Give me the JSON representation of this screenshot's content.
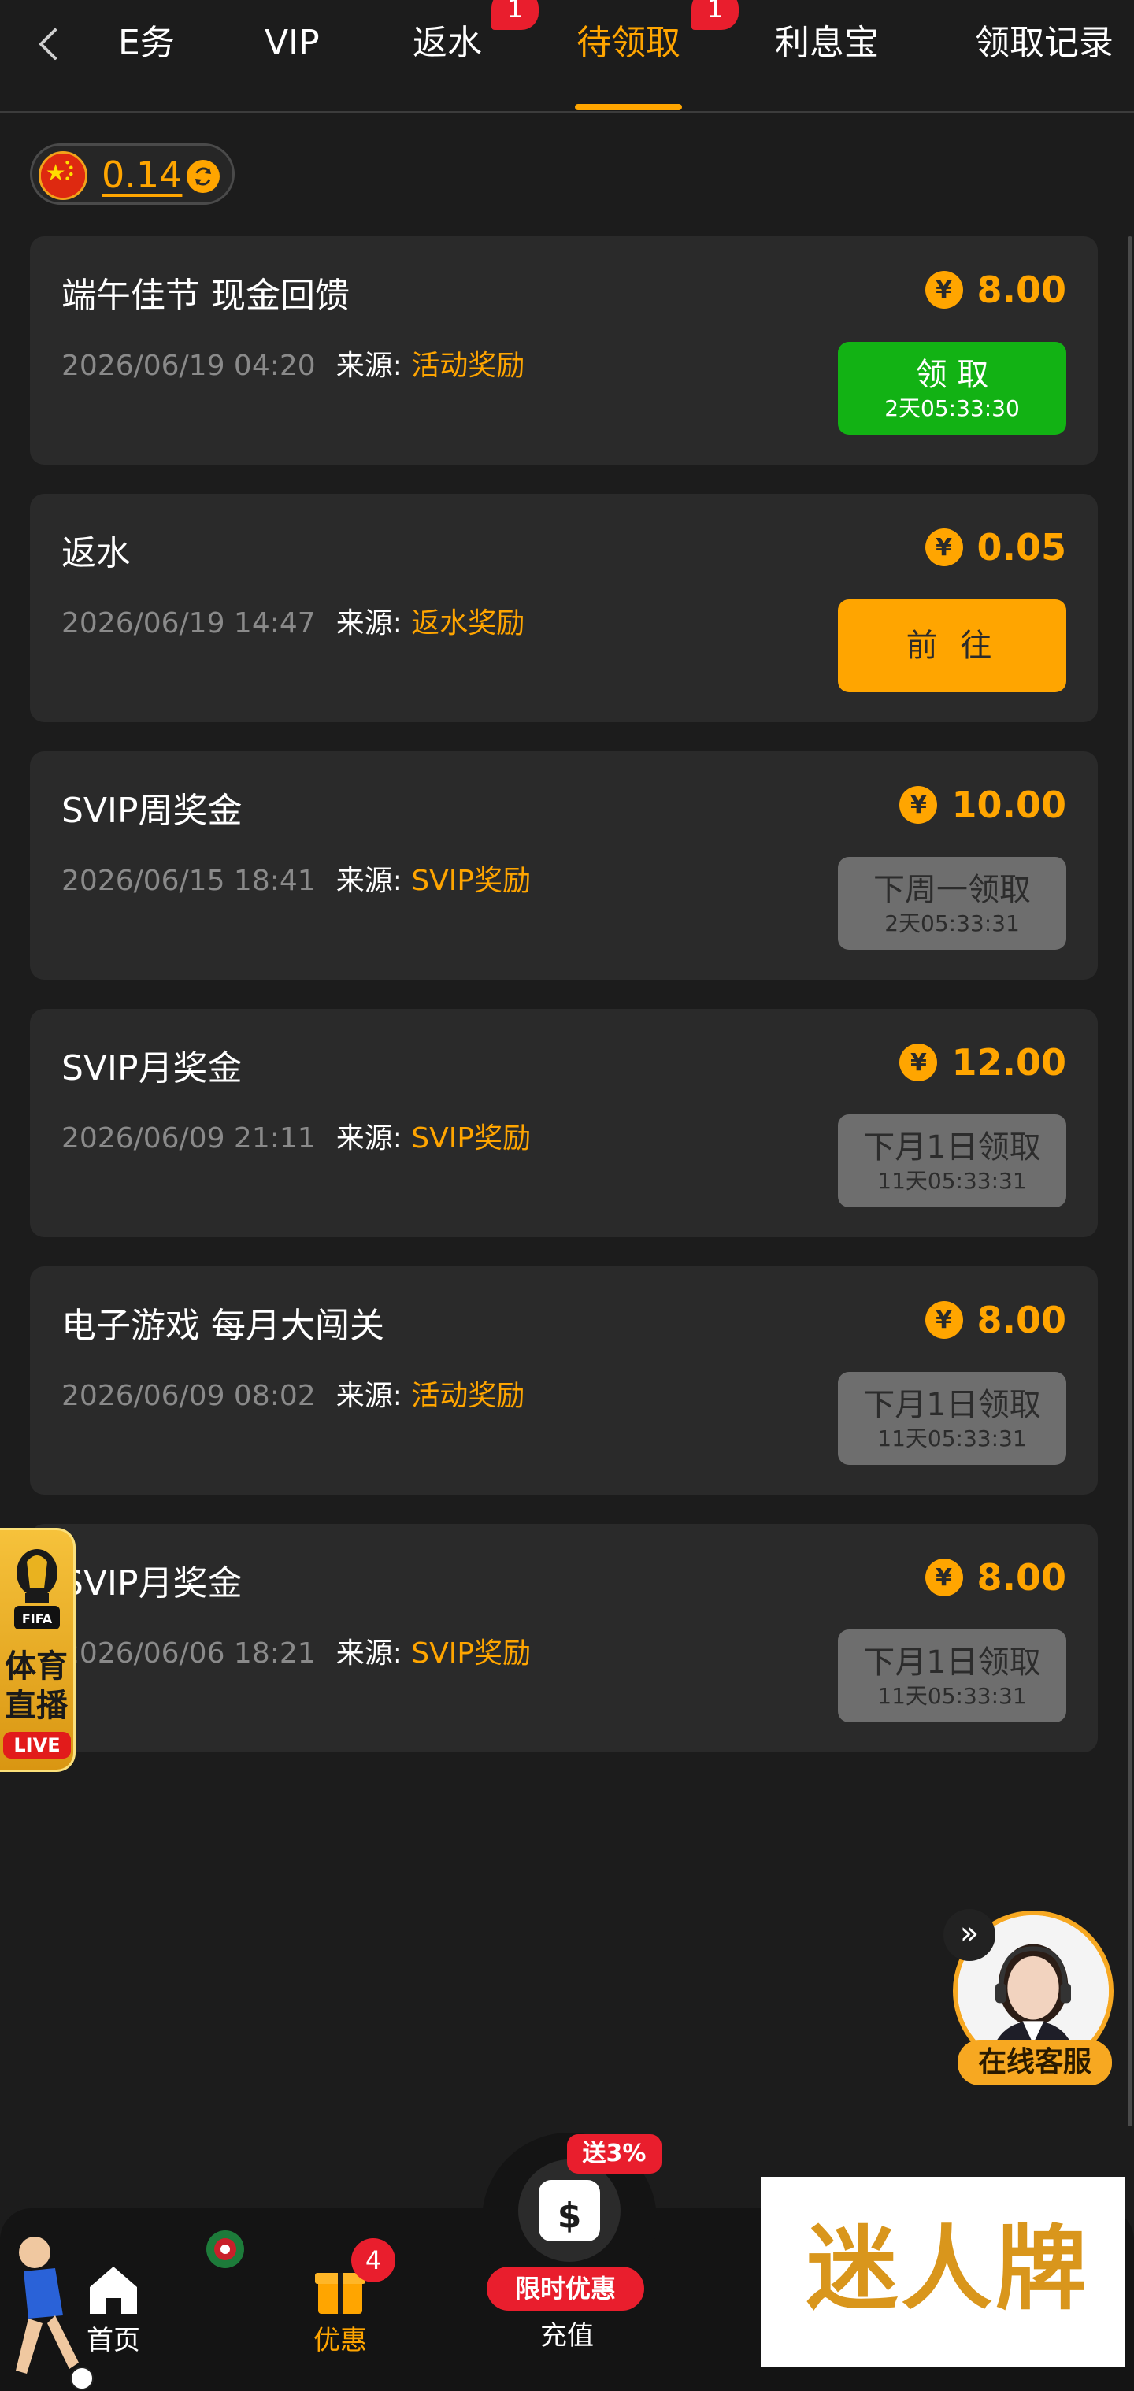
{
  "tabs": [
    {
      "label": "E务"
    },
    {
      "label": "VIP"
    },
    {
      "label": "返水",
      "badge": "1"
    },
    {
      "label": "待领取",
      "badge": "1",
      "active": true
    },
    {
      "label": "利息宝"
    },
    {
      "label": "领取记录"
    }
  ],
  "balance": {
    "amount": "0.14"
  },
  "cards": [
    {
      "title": "端午佳节 现金回馈",
      "amount": "8.00",
      "date": "2026/06/19 04:20",
      "source_label": "来源:",
      "source": "活动奖励",
      "button": "领 取",
      "button_sub": "2天05:33:30",
      "button_style": "green"
    },
    {
      "title": "返水",
      "amount": "0.05",
      "date": "2026/06/19 14:47",
      "source_label": "来源:",
      "source": "返水奖励",
      "button": "前 往",
      "button_sub": "",
      "button_style": "orange"
    },
    {
      "title": "SVIP周奖金",
      "amount": "10.00",
      "date": "2026/06/15 18:41",
      "source_label": "来源:",
      "source": "SVIP奖励",
      "button": "下周一领取",
      "button_sub": "2天05:33:31",
      "button_style": "gray"
    },
    {
      "title": "SVIP月奖金",
      "amount": "12.00",
      "date": "2026/06/09 21:11",
      "source_label": "来源:",
      "source": "SVIP奖励",
      "button": "下月1日领取",
      "button_sub": "11天05:33:31",
      "button_style": "gray"
    },
    {
      "title": "电子游戏 每月大闯关",
      "amount": "8.00",
      "date": "2026/06/09 08:02",
      "source_label": "来源:",
      "source": "活动奖励",
      "button": "下月1日领取",
      "button_sub": "11天05:33:31",
      "button_style": "gray"
    },
    {
      "title": "SVIP月奖金",
      "amount": "8.00",
      "date": "2026/06/06 18:21",
      "source_label": "来源:",
      "source": "SVIP奖励",
      "button": "下月1日领取",
      "button_sub": "11天05:33:31",
      "button_style": "gray"
    }
  ],
  "currency_symbol": "¥",
  "sports_float": {
    "text": "体育直播",
    "trophy_label": "FIFA",
    "live": "LIVE"
  },
  "customer_service": {
    "label": "在线客服",
    "collapse_icon": "double-chevron-right-icon"
  },
  "bottom_nav": {
    "home": "首页",
    "promo": "优惠",
    "promo_badge": "4",
    "recharge": "充值",
    "recharge_promo": "送3%",
    "recharge_limit": "限时优惠"
  },
  "ad_banner": {
    "text": "迷人牌"
  },
  "colors": {
    "accent": "#ffa500",
    "green": "#12b214",
    "gray_button": "#6e6e6e",
    "badge": "#e91e2d",
    "card": "#2a2a2a",
    "background": "#1c1c1c"
  }
}
